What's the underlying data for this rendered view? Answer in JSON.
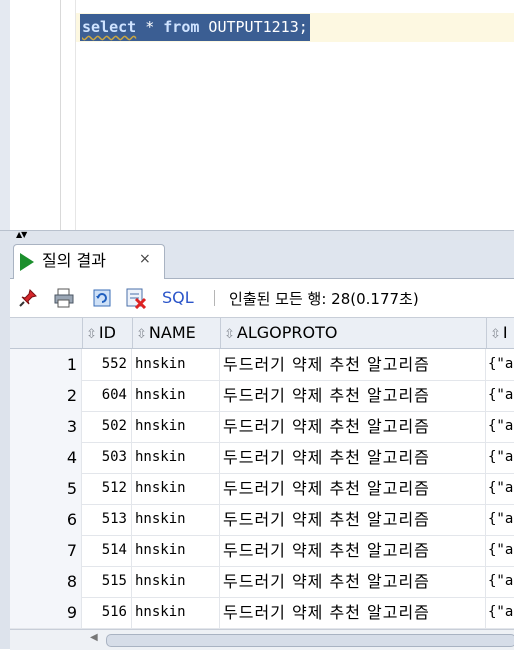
{
  "editor": {
    "query_keyword_select": "select",
    "query_rest_1": " * ",
    "query_keyword_from": "from",
    "query_rest_2": " OUTPUT1213;"
  },
  "results_tab": {
    "title": "질의 결과",
    "close_glyph": "×"
  },
  "toolbar": {
    "sql_label": "SQL",
    "status": "인출된 모든 행: 28(0.177초)"
  },
  "grid": {
    "columns": [
      "ID",
      "NAME",
      "ALGOPROTO",
      "I"
    ],
    "rows": [
      {
        "n": "1",
        "id": "552",
        "name": "hnskin",
        "algo": "두드러기 약제 추천 알고리즘",
        "next": "{\"a"
      },
      {
        "n": "2",
        "id": "604",
        "name": "hnskin",
        "algo": "두드러기 약제 추천 알고리즘",
        "next": "{\"a"
      },
      {
        "n": "3",
        "id": "502",
        "name": "hnskin",
        "algo": "두드러기 약제 추천 알고리즘",
        "next": "{\"a"
      },
      {
        "n": "4",
        "id": "503",
        "name": "hnskin",
        "algo": "두드러기 약제 추천 알고리즘",
        "next": "{\"a"
      },
      {
        "n": "5",
        "id": "512",
        "name": "hnskin",
        "algo": "두드러기 약제 추천 알고리즘",
        "next": "{\"a"
      },
      {
        "n": "6",
        "id": "513",
        "name": "hnskin",
        "algo": "두드러기 약제 추천 알고리즘",
        "next": "{\"a"
      },
      {
        "n": "7",
        "id": "514",
        "name": "hnskin",
        "algo": "두드러기 약제 추천 알고리즘",
        "next": "{\"a"
      },
      {
        "n": "8",
        "id": "515",
        "name": "hnskin",
        "algo": "두드러기 약제 추천 알고리즘",
        "next": "{\"a"
      },
      {
        "n": "9",
        "id": "516",
        "name": "hnskin",
        "algo": "두드러기 약제 추천 알고리즘",
        "next": "{\"a"
      }
    ]
  },
  "icons": {
    "play": "play-icon",
    "pin": "pin-icon",
    "print": "print-icon",
    "refresh": "refresh-icon",
    "export": "export-icon",
    "sort": "sort-icon"
  },
  "colors": {
    "selection": "#3b5e93",
    "play": "#1c8f2d",
    "sql_link": "#2b55c9"
  }
}
